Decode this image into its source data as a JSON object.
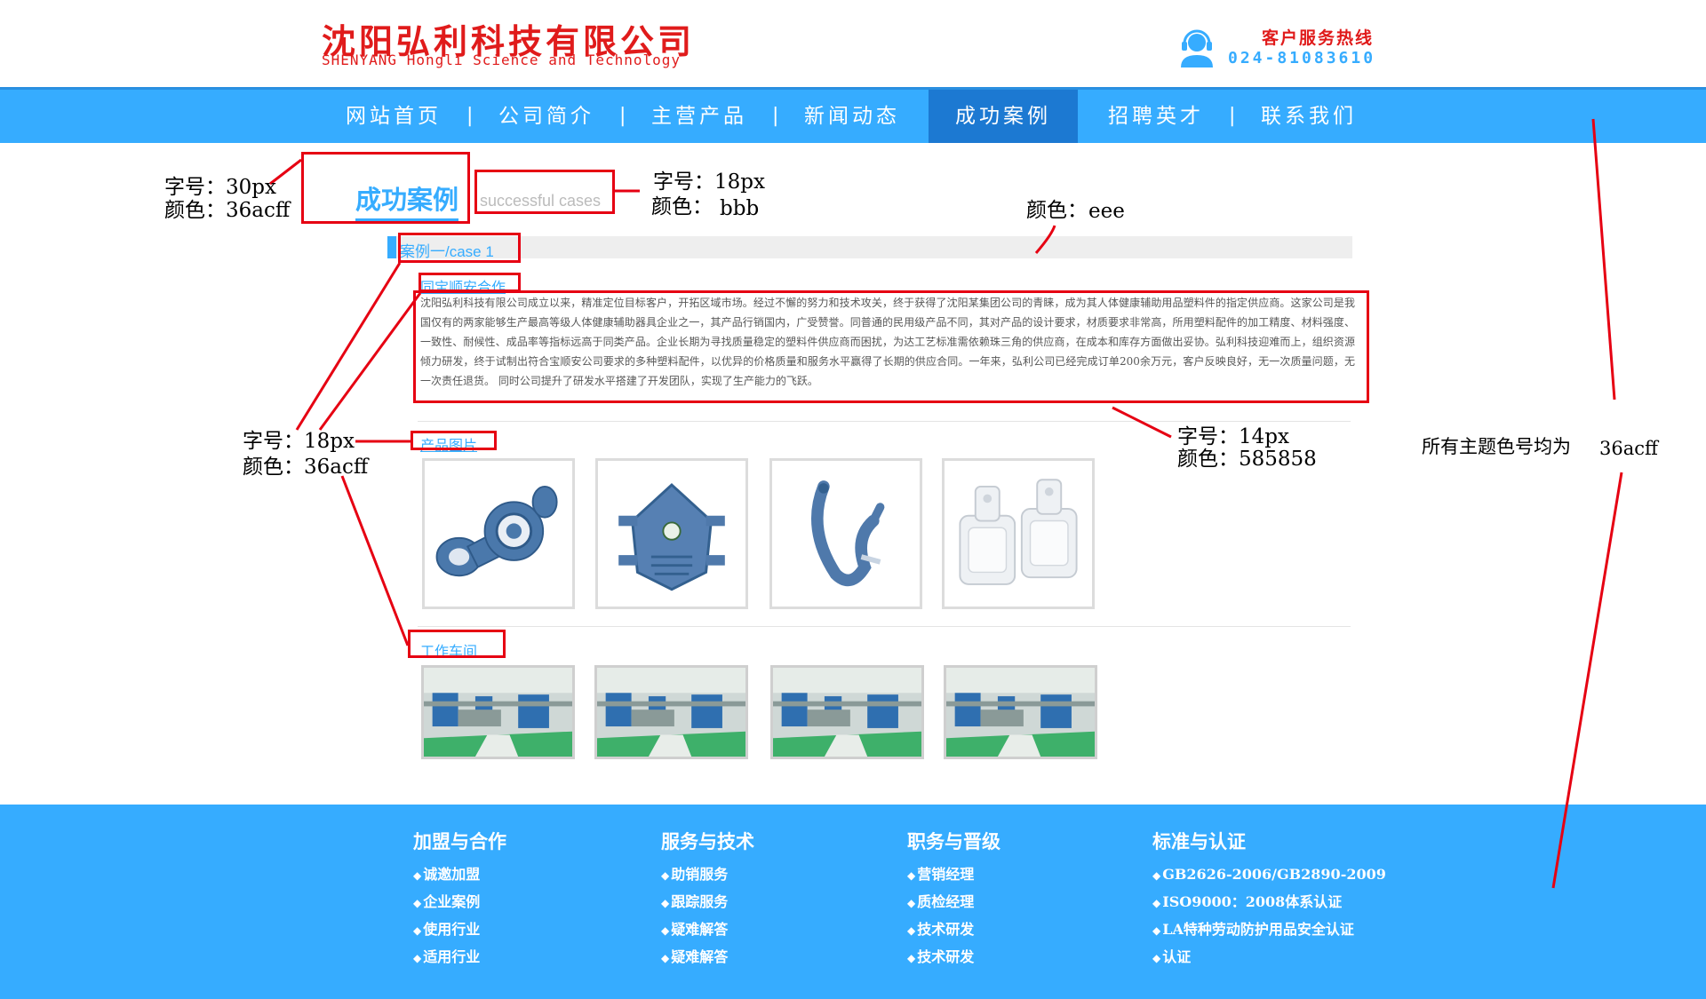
{
  "header": {
    "company_cn": "沈阳弘利科技有限公司",
    "company_en": "SHENYANG Hongli Science and Technology",
    "hotline_label": "客户服务热线",
    "hotline_number": "024-81083610",
    "hotline_icon": "customer-service-headset-icon",
    "brand_color": "#e01b1b"
  },
  "nav": {
    "items": [
      {
        "label": "网站首页"
      },
      {
        "label": "公司简介"
      },
      {
        "label": "主营产品"
      },
      {
        "label": "新闻动态"
      },
      {
        "label": "成功案例"
      },
      {
        "label": "招聘英才"
      },
      {
        "label": "联系我们"
      }
    ],
    "active_index": 4,
    "separator": "|",
    "bg_color": "#36acff",
    "active_color": "#1c79d2"
  },
  "main": {
    "title": "成功案例",
    "subtitle": "successful cases",
    "case_label": "案例一/case 1",
    "case_heading": "同宝顺安合作",
    "case_text": "沈阳弘利科技有限公司成立以来，精准定位目标客户，开拓区域市场。经过不懈的努力和技术攻关，终于获得了沈阳某集团公司的青睐，成为其人体健康辅助用品塑料件的指定供应商。这家公司是我国仅有的两家能够生产最高等级人体健康辅助器具企业之一，其产品行销国内，广受赞誉。同普通的民用级产品不同，其对产品的设计要求，材质要求非常高，所用塑料配件的加工精度、材料强度、一致性、耐候性、成品率等指标远高于同类产品。企业长期为寻找质量稳定的塑料件供应商而困扰，为达工艺标准需依赖珠三角的供应商，在成本和库存方面做出妥协。弘利科技迎难而上，组织资源倾力研发，终于试制出符合宝顺安公司要求的多种塑料配件，以优异的价格质量和服务水平赢得了长期的供应合同。一年来，弘利公司已经完成订单200余万元，客户反映良好，无一次质量问题，无一次责任退货。 同时公司提升了研发水平搭建了开发团队，实现了生产能力的飞跃。",
    "product_heading": "产品图片",
    "workshop_heading": "工作车间",
    "product_images": [
      "respirator-filter-part",
      "half-face-mask",
      "mask-head-strap",
      "clear-plastic-cups"
    ],
    "workshop_images": [
      "factory-workshop",
      "factory-workshop",
      "factory-workshop",
      "factory-workshop"
    ],
    "theme_color": "#36acff",
    "text_color": "#585858",
    "bar_color": "#eeeeee",
    "subtitle_color": "#bbbbbb"
  },
  "annotations": {
    "title_size": "字号：30px",
    "title_color": "颜色：36acff",
    "subtitle_size": "字号：18px",
    "subtitle_color_label": "颜色：",
    "subtitle_color_value": "bbb",
    "bar_color_label": "颜色：",
    "bar_color_value": "eee",
    "heading_size": "字号：18px",
    "heading_color": "颜色：36acff",
    "text_size": "字号：14px",
    "text_color": "颜色：585858",
    "theme_note_label": "所有主题色号均为",
    "theme_note_value": "36acff",
    "annotation_color": "#e60012"
  },
  "footer": {
    "bg_color": "#36acff",
    "columns": [
      {
        "title": "加盟与合作",
        "links": [
          "诚邀加盟",
          "企业案例",
          "使用行业",
          "适用行业"
        ]
      },
      {
        "title": "服务与技术",
        "links": [
          "助销服务",
          "跟踪服务",
          "疑难解答",
          "疑难解答"
        ]
      },
      {
        "title": "职务与晋级",
        "links": [
          "营销经理",
          "质检经理",
          "技术研发",
          "技术研发"
        ]
      },
      {
        "title": "标准与认证",
        "links": [
          "GB2626-2006/GB2890-2009",
          "ISO9000：2008体系认证",
          "LA特种劳动防护用品安全认证",
          "认证"
        ]
      }
    ]
  }
}
